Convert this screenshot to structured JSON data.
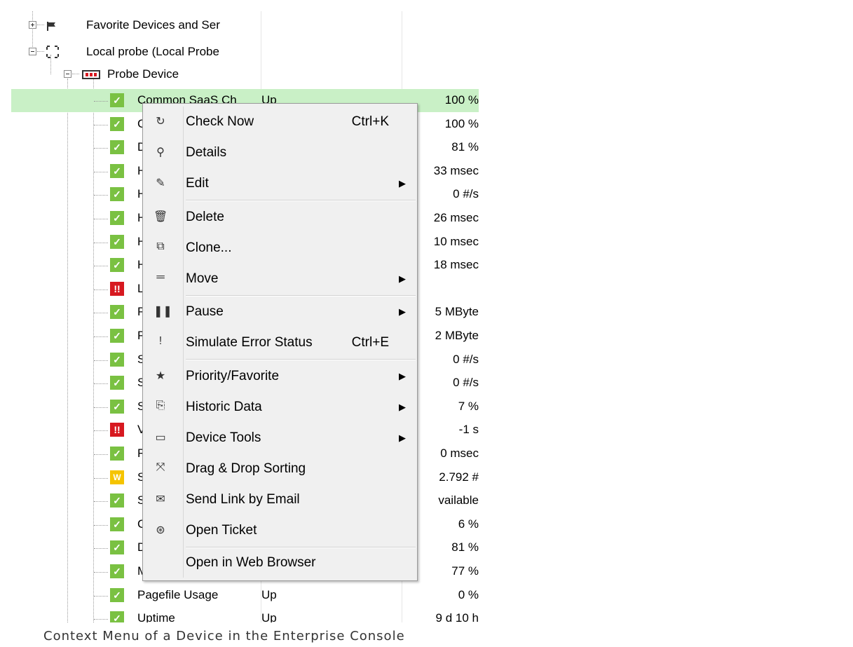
{
  "tree": {
    "favorites_label": "Favorite Devices and Ser",
    "probe_label": "Local probe (Local Probe",
    "device_label": "Probe Device"
  },
  "sensors": [
    {
      "name": "Common SaaS Ch",
      "status": "Up",
      "value": "100 %",
      "state": "ok"
    },
    {
      "name": "C",
      "status": "",
      "value": "100 %",
      "state": "ok"
    },
    {
      "name": "D",
      "status": "",
      "value": "81 %",
      "state": "ok"
    },
    {
      "name": "H",
      "status": "",
      "value": "33 msec",
      "state": "ok"
    },
    {
      "name": "H",
      "status": "",
      "value": "0 #/s",
      "state": "ok"
    },
    {
      "name": "H",
      "status": "",
      "value": "26 msec",
      "state": "ok"
    },
    {
      "name": "H",
      "status": "",
      "value": "10 msec",
      "state": "ok"
    },
    {
      "name": "H",
      "status": "",
      "value": "18 msec",
      "state": "ok"
    },
    {
      "name": "L",
      "status": "",
      "value": "",
      "state": "down"
    },
    {
      "name": "P",
      "status": "",
      "value": "5 MByte",
      "state": "ok"
    },
    {
      "name": "P",
      "status": "",
      "value": "2 MByte",
      "state": "ok"
    },
    {
      "name": "S",
      "status": "",
      "value": "0 #/s",
      "state": "ok"
    },
    {
      "name": "S",
      "status": "",
      "value": "0 #/s",
      "state": "ok"
    },
    {
      "name": "S",
      "status": "",
      "value": "7 %",
      "state": "ok"
    },
    {
      "name": "V",
      "status": "",
      "value": "-1 s",
      "state": "down"
    },
    {
      "name": "R",
      "status": "",
      "value": "0 msec",
      "state": "ok"
    },
    {
      "name": "S",
      "status": "",
      "value": "2.792 #",
      "state": "warn"
    },
    {
      "name": "S",
      "status": "",
      "value": "vailable",
      "state": "ok"
    },
    {
      "name": "C",
      "status": "",
      "value": "6 %",
      "state": "ok"
    },
    {
      "name": "D",
      "status": "",
      "value": "81 %",
      "state": "ok"
    },
    {
      "name": "M",
      "status": "",
      "value": "77 %",
      "state": "ok"
    },
    {
      "name": "Pagefile Usage",
      "status": "Up",
      "value": "0 %",
      "state": "ok"
    },
    {
      "name": "Uptime",
      "status": "Up",
      "value": "9 d 10 h",
      "state": "ok"
    }
  ],
  "status_glyphs": {
    "ok": "✓",
    "down": "!!",
    "warn": "W"
  },
  "colors": {
    "ok": "#7ac142",
    "down": "#d71920",
    "warn": "#f5c400",
    "selected_row": "#c9f0c6"
  },
  "context_menu": {
    "items": [
      {
        "label": "Check Now",
        "shortcut": "Ctrl+K",
        "icon": "refresh-icon",
        "glyph": "↻",
        "submenu": false
      },
      {
        "label": "Details",
        "shortcut": "",
        "icon": "search-icon",
        "glyph": "⚲",
        "submenu": false
      },
      {
        "label": "Edit",
        "shortcut": "",
        "icon": "pencil-icon",
        "glyph": "✎",
        "submenu": true
      },
      {
        "label": "Delete",
        "shortcut": "",
        "icon": "trash-icon",
        "glyph": "🗑",
        "submenu": false
      },
      {
        "label": "Clone...",
        "shortcut": "",
        "icon": "clone-icon",
        "glyph": "⧉",
        "submenu": false
      },
      {
        "label": "Move",
        "shortcut": "",
        "icon": "move-icon",
        "glyph": "═",
        "submenu": true
      },
      {
        "label": "Pause",
        "shortcut": "",
        "icon": "pause-icon",
        "glyph": "❚❚",
        "submenu": true
      },
      {
        "label": "Simulate Error Status",
        "shortcut": "Ctrl+E",
        "icon": "exclamation-icon",
        "glyph": "!",
        "submenu": false
      },
      {
        "label": "Priority/Favorite",
        "shortcut": "",
        "icon": "star-icon",
        "glyph": "★",
        "submenu": true
      },
      {
        "label": "Historic Data",
        "shortcut": "",
        "icon": "scroll-icon",
        "glyph": "⎘",
        "submenu": true
      },
      {
        "label": "Device Tools",
        "shortcut": "",
        "icon": "tools-icon",
        "glyph": "▭",
        "submenu": true
      },
      {
        "label": "Drag & Drop Sorting",
        "shortcut": "",
        "icon": "drag-icon",
        "glyph": "⤧",
        "submenu": false
      },
      {
        "label": "Send Link by Email",
        "shortcut": "",
        "icon": "mail-icon",
        "glyph": "✉",
        "submenu": false
      },
      {
        "label": "Open Ticket",
        "shortcut": "",
        "icon": "ticket-icon",
        "glyph": "⊛",
        "submenu": false
      },
      {
        "label": "Open in Web Browser",
        "shortcut": "",
        "icon": "",
        "glyph": "",
        "submenu": false
      }
    ],
    "submenu_arrow": "▶"
  },
  "caption": "Context Menu of a Device in the Enterprise Console"
}
